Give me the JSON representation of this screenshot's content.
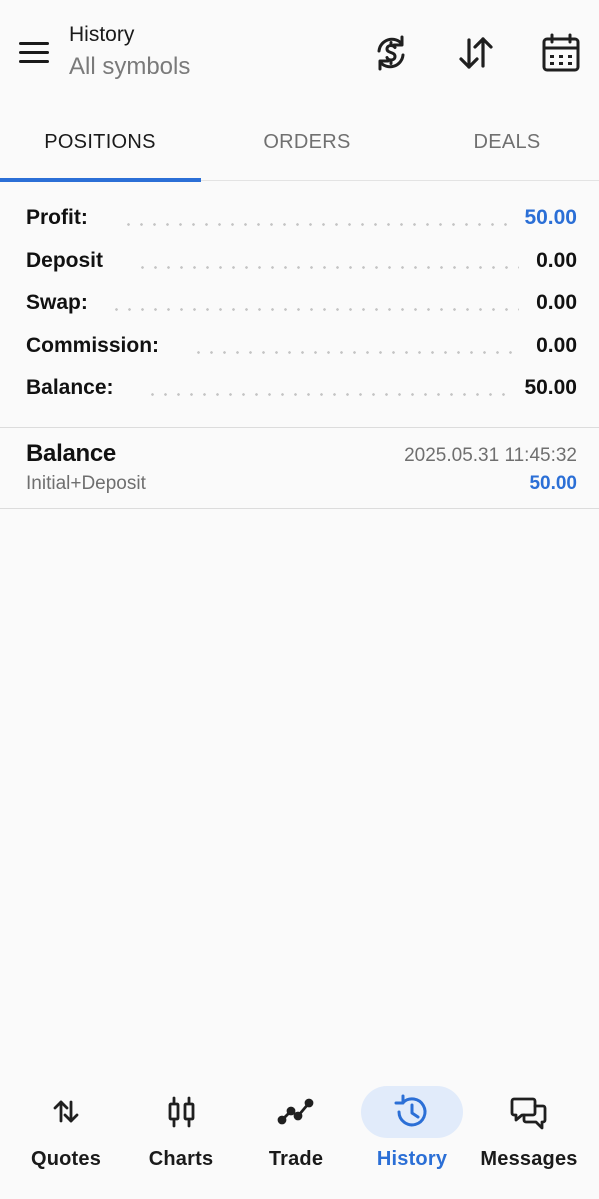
{
  "header": {
    "title": "History",
    "subtitle": "All symbols",
    "icons": [
      "menu-icon",
      "currency-exchange-icon",
      "sort-icon",
      "calendar-icon"
    ]
  },
  "tabs": [
    {
      "label": "POSITIONS",
      "active": true
    },
    {
      "label": "ORDERS",
      "active": false
    },
    {
      "label": "DEALS",
      "active": false
    }
  ],
  "summary": [
    {
      "label": "Profit:",
      "value": "50.00",
      "highlight": true
    },
    {
      "label": "Deposit",
      "value": "0.00",
      "highlight": false
    },
    {
      "label": "Swap:",
      "value": "0.00",
      "highlight": false
    },
    {
      "label": "Commission:",
      "value": "0.00",
      "highlight": false
    },
    {
      "label": "Balance:",
      "value": "50.00",
      "highlight": false
    }
  ],
  "deals": [
    {
      "type": "Balance",
      "time": "2025.05.31 11:45:32",
      "comment": "Initial+Deposit",
      "amount": "50.00"
    }
  ],
  "bottom_nav": [
    {
      "label": "Quotes",
      "icon": "quotes-icon",
      "active": false
    },
    {
      "label": "Charts",
      "icon": "candlestick-icon",
      "active": false
    },
    {
      "label": "Trade",
      "icon": "trade-line-icon",
      "active": false
    },
    {
      "label": "History",
      "icon": "history-icon",
      "active": true
    },
    {
      "label": "Messages",
      "icon": "messages-icon",
      "active": false
    }
  ],
  "colors": {
    "accent": "#2b6fd6",
    "active_nav_background": "#e1ebfa",
    "background": "#fafafa",
    "secondary_text": "#6f6f6f"
  }
}
